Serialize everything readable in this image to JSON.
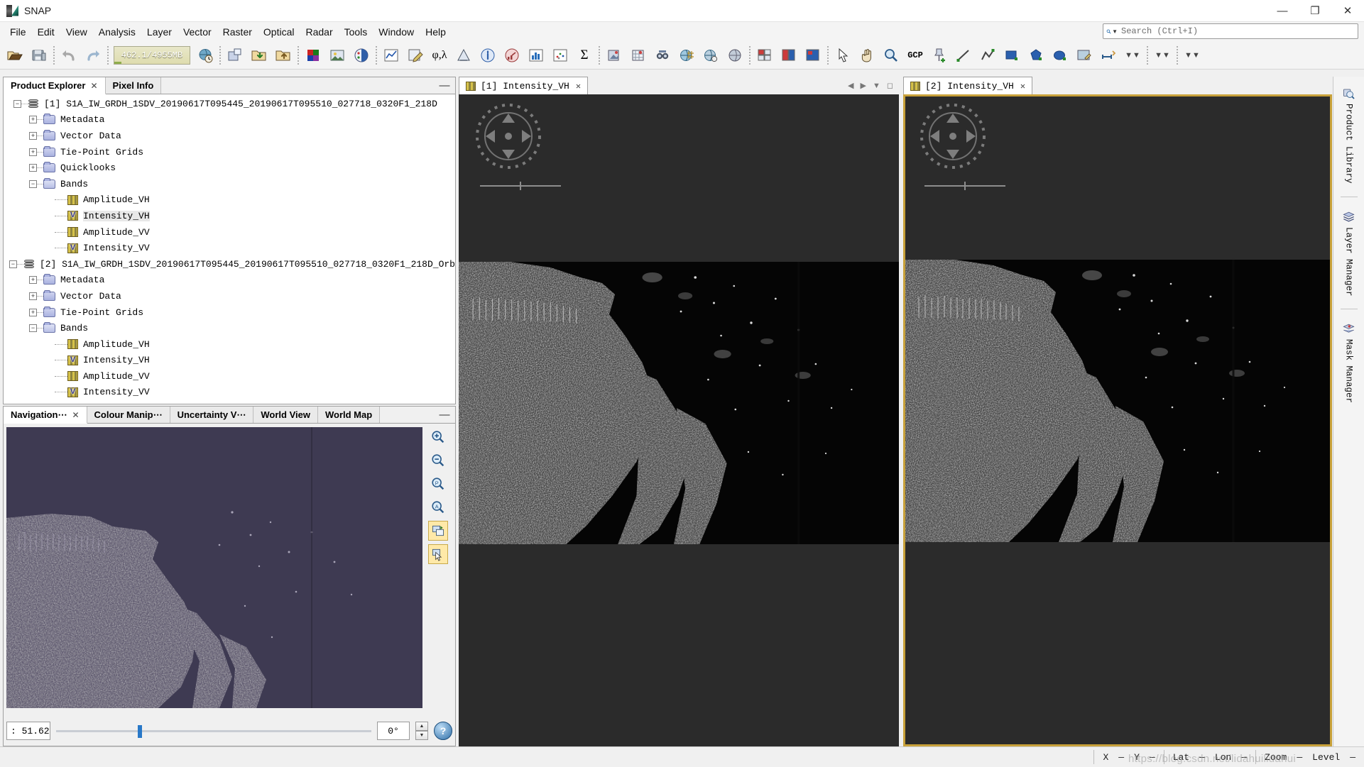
{
  "window": {
    "title": "SNAP",
    "logo_icon": "snap-logo-icon",
    "minimize": "—",
    "maximize": "❐",
    "close": "✕"
  },
  "menubar": {
    "items": [
      {
        "label": "File"
      },
      {
        "label": "Edit"
      },
      {
        "label": "View"
      },
      {
        "label": "Analysis"
      },
      {
        "label": "Layer"
      },
      {
        "label": "Vector"
      },
      {
        "label": "Raster"
      },
      {
        "label": "Optical"
      },
      {
        "label": "Radar"
      },
      {
        "label": "Tools"
      },
      {
        "label": "Window"
      },
      {
        "label": "Help"
      }
    ]
  },
  "search": {
    "icon": "search-icon",
    "placeholder": "Search (Ctrl+I)"
  },
  "toolbar": {
    "memory_label": "462.1/4955MB",
    "buttons": [
      {
        "name": "open-product-button",
        "icon": "open-folder-icon"
      },
      {
        "name": "save-product-button",
        "icon": "save-disk-icon"
      },
      {
        "name": "undo-button",
        "icon": "undo-arrow-icon"
      },
      {
        "name": "redo-button",
        "icon": "redo-arrow-icon"
      },
      {
        "name": "memory-monitor",
        "icon": "memory-gauge-icon"
      },
      {
        "name": "reopen-product-button",
        "icon": "globe-clock-icon"
      },
      {
        "name": "open-raster-button",
        "icon": "raster-window-icon"
      },
      {
        "name": "import-button",
        "icon": "folder-down-icon"
      },
      {
        "name": "export-button",
        "icon": "folder-up-icon"
      },
      {
        "name": "rgb-image-window-button",
        "icon": "rgb-squares-icon"
      },
      {
        "name": "open-image-view-button",
        "icon": "image-view-icon"
      },
      {
        "name": "colour-manipulation-button",
        "icon": "colour-palette-icon"
      },
      {
        "name": "profile-plot-button",
        "icon": "line-plot-icon"
      },
      {
        "name": "filtered-band-button",
        "icon": "filter-pencil-icon"
      },
      {
        "name": "geo-coding-button",
        "icon": "phi-lambda-icon"
      },
      {
        "name": "information-button",
        "icon": "histogram-icon"
      },
      {
        "name": "product-metadata-button",
        "icon": "info-circle-icon"
      },
      {
        "name": "statistics-button",
        "icon": "stats-gauge-icon"
      },
      {
        "name": "histogram-button",
        "icon": "histogram-bars-icon"
      },
      {
        "name": "scatter-plot-button",
        "icon": "scatter-plot-icon"
      },
      {
        "name": "sum-button",
        "icon": "sigma-icon"
      },
      {
        "name": "mask-manager-button",
        "icon": "mask-icon"
      },
      {
        "name": "pin-manager-button",
        "icon": "pin-grid-icon"
      },
      {
        "name": "no-data-overlay-button",
        "icon": "binocular-icon"
      },
      {
        "name": "graticule-overlay-button",
        "icon": "graticule-globe-icon"
      },
      {
        "name": "pixel-info-button",
        "icon": "pixel-globe-icon"
      },
      {
        "name": "gcp-manager-button",
        "icon": "gcp-label-icon"
      },
      {
        "name": "tile-windows-button",
        "icon": "tile-windows-icon"
      },
      {
        "name": "tile-horizontal-button",
        "icon": "tile-horizontal-icon"
      },
      {
        "name": "tile-single-button",
        "icon": "tile-single-icon"
      },
      {
        "name": "selection-tool-button",
        "icon": "arrow-cursor-icon"
      },
      {
        "name": "pan-tool-button",
        "icon": "hand-icon"
      },
      {
        "name": "zoom-tool-button",
        "icon": "magnifier-icon"
      },
      {
        "name": "gcp-placing-tool-button",
        "icon": "gcp-pin-icon"
      },
      {
        "name": "pin-placing-tool-button",
        "icon": "pin-plus-icon"
      },
      {
        "name": "line-drawing-tool-button",
        "icon": "line-tool-icon"
      },
      {
        "name": "polyline-drawing-tool-button",
        "icon": "polyline-tool-icon"
      },
      {
        "name": "rectangle-drawing-tool-button",
        "icon": "rectangle-tool-icon"
      },
      {
        "name": "polygon-drawing-tool-button",
        "icon": "polygon-tool-icon"
      },
      {
        "name": "ellipse-drawing-tool-button",
        "icon": "ellipse-tool-icon"
      },
      {
        "name": "magic-wand-button",
        "icon": "magic-wand-icon"
      },
      {
        "name": "range-finder-button",
        "icon": "range-finder-icon"
      }
    ],
    "overflow_icon": "chevron-double-down-icon"
  },
  "product_explorer": {
    "tabs": [
      {
        "label": "Product Explorer",
        "active": true,
        "closable": true
      },
      {
        "label": "Pixel Info",
        "active": false,
        "closable": false
      }
    ],
    "minimize_icon": "minimize-icon",
    "tree": [
      {
        "label": "[1] S1A_IW_GRDH_1SDV_20190617T095445_20190617T095510_027718_0320F1_218D",
        "icon": "product-icon",
        "expanded": true,
        "level": 0,
        "children": [
          {
            "label": "Metadata",
            "icon": "folder-icon",
            "expanded": false,
            "level": 1
          },
          {
            "label": "Vector Data",
            "icon": "folder-icon",
            "expanded": false,
            "level": 1
          },
          {
            "label": "Tie-Point Grids",
            "icon": "folder-icon",
            "expanded": false,
            "level": 1
          },
          {
            "label": "Quicklooks",
            "icon": "folder-icon",
            "expanded": false,
            "level": 1
          },
          {
            "label": "Bands",
            "icon": "folder-open-icon",
            "expanded": true,
            "level": 1,
            "children": [
              {
                "label": "Amplitude_VH",
                "icon": "band-icon",
                "level": 2,
                "virtual": false,
                "selected": false
              },
              {
                "label": "Intensity_VH",
                "icon": "virtual-band-icon",
                "level": 2,
                "virtual": true,
                "selected": true
              },
              {
                "label": "Amplitude_VV",
                "icon": "band-icon",
                "level": 2,
                "virtual": false,
                "selected": false
              },
              {
                "label": "Intensity_VV",
                "icon": "virtual-band-icon",
                "level": 2,
                "virtual": true,
                "selected": false
              }
            ]
          }
        ]
      },
      {
        "label": "[2] S1A_IW_GRDH_1SDV_20190617T095445_20190617T095510_027718_0320F1_218D_Orb",
        "icon": "product-icon",
        "expanded": true,
        "level": 0,
        "children": [
          {
            "label": "Metadata",
            "icon": "folder-icon",
            "expanded": false,
            "level": 1
          },
          {
            "label": "Vector Data",
            "icon": "folder-icon",
            "expanded": false,
            "level": 1
          },
          {
            "label": "Tie-Point Grids",
            "icon": "folder-icon",
            "expanded": false,
            "level": 1
          },
          {
            "label": "Bands",
            "icon": "folder-open-icon",
            "expanded": true,
            "level": 1,
            "children": [
              {
                "label": "Amplitude_VH",
                "icon": "band-icon",
                "level": 2,
                "virtual": false,
                "selected": false
              },
              {
                "label": "Intensity_VH",
                "icon": "virtual-band-icon",
                "level": 2,
                "virtual": true,
                "selected": false
              },
              {
                "label": "Amplitude_VV",
                "icon": "band-icon",
                "level": 2,
                "virtual": false,
                "selected": false
              },
              {
                "label": "Intensity_VV",
                "icon": "virtual-band-icon",
                "level": 2,
                "virtual": true,
                "selected": false
              }
            ]
          }
        ]
      }
    ]
  },
  "navigation": {
    "tabs": [
      {
        "label": "Navigation⋯",
        "active": true,
        "closable": true
      },
      {
        "label": "Colour Manip⋯",
        "active": false,
        "closable": false
      },
      {
        "label": "Uncertainty V⋯",
        "active": false,
        "closable": false
      },
      {
        "label": "World View",
        "active": false,
        "closable": false
      },
      {
        "label": "World Map",
        "active": false,
        "closable": false
      }
    ],
    "minimize_icon": "minimize-icon",
    "tools": [
      {
        "name": "zoom-in-button",
        "icon": "zoom-in-icon"
      },
      {
        "name": "zoom-out-button",
        "icon": "zoom-out-icon"
      },
      {
        "name": "zoom-to-pixel-resolution-button",
        "icon": "zoom-pixel-icon"
      },
      {
        "name": "zoom-all-button",
        "icon": "zoom-all-icon"
      },
      {
        "name": "sync-views-button",
        "icon": "sync-views-icon",
        "pressed": true
      },
      {
        "name": "sync-cursors-button",
        "icon": "sync-cursor-icon",
        "pressed": true
      }
    ],
    "zoom_value": ": 51.62",
    "rotation_value": "0°",
    "spinner_up_icon": "spinner-up-icon",
    "spinner_down_icon": "spinner-down-icon",
    "help_label": "?"
  },
  "views": [
    {
      "tab_label": "[1] Intensity_VH",
      "tab_icon": "band-icon",
      "close_icon": "close-icon",
      "focused": false,
      "controls": {
        "prev_icon": "chevron-left-icon",
        "next_icon": "chevron-right-icon",
        "list_icon": "chevron-down-icon",
        "maximize_icon": "maximize-icon"
      },
      "compass_icon": "navigation-compass-icon"
    },
    {
      "tab_label": "[2] Intensity_VH",
      "tab_icon": "band-icon",
      "close_icon": "close-icon",
      "focused": true,
      "controls": {
        "prev_icon": "chevron-left-icon",
        "next_icon": "chevron-right-icon",
        "list_icon": "chevron-down-icon",
        "maximize_icon": "maximize-icon"
      },
      "compass_icon": "navigation-compass-icon"
    }
  ],
  "right_sidebar": {
    "items": [
      {
        "label": "Product Library",
        "icon": "product-library-icon"
      },
      {
        "label": "Layer Manager",
        "icon": "layers-icon"
      },
      {
        "label": "Mask Manager",
        "icon": "mask-manager-icon"
      }
    ]
  },
  "statusbar": {
    "x_label": "X",
    "x_value": "—",
    "y_label": "Y",
    "y_value": "—",
    "lat_label": "Lat",
    "lat_value": "—",
    "lon_label": "Lon",
    "lon_value": "—",
    "zoom_label": "Zoom",
    "zoom_value": "—",
    "level_label": "Level",
    "level_value": "—"
  },
  "watermark": "https://blog.csdn.net/lidahuilidahui",
  "colors": {
    "focus_border": "#c8a13a",
    "accent": "#2878c8",
    "canvas_bg": "#2b2b2b",
    "nav_canvas_bg": "#3e3a52"
  }
}
